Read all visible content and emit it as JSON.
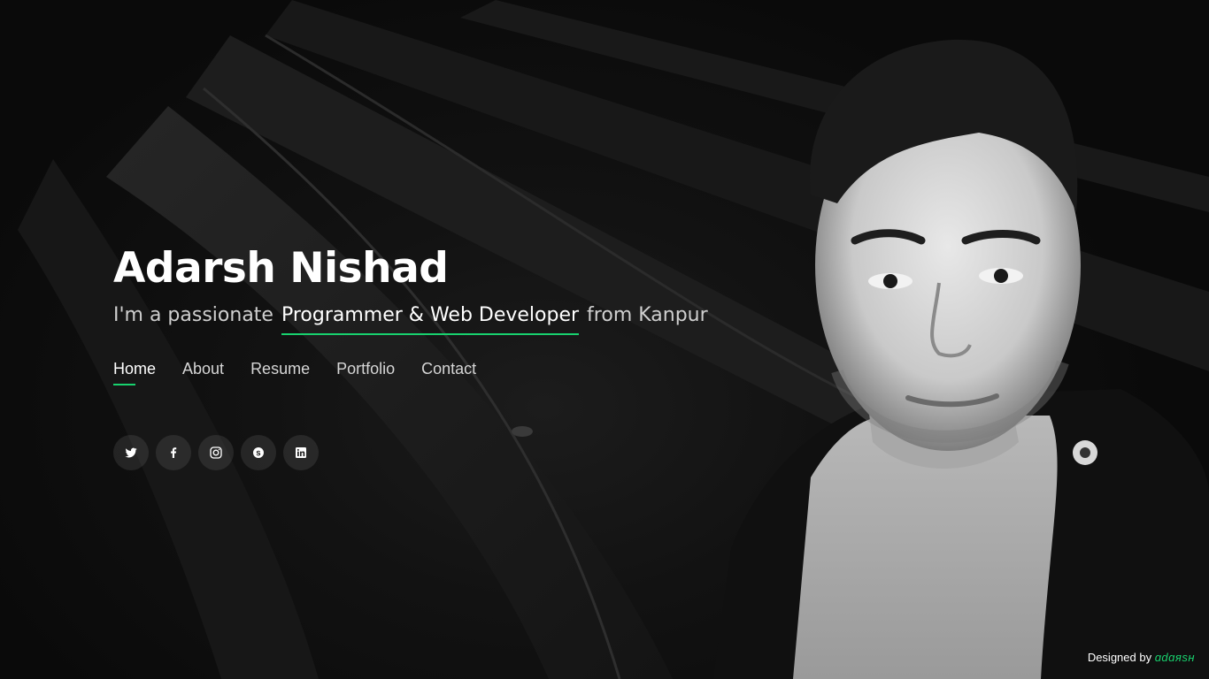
{
  "hero": {
    "name": "Adarsh Nishad",
    "tagline_prefix": "I'm a passionate ",
    "tagline_highlight": "Programmer & Web Developer",
    "tagline_suffix": " from Kanpur"
  },
  "nav": {
    "items": [
      {
        "label": "Home",
        "active": true
      },
      {
        "label": "About",
        "active": false
      },
      {
        "label": "Resume",
        "active": false
      },
      {
        "label": "Portfolio",
        "active": false
      },
      {
        "label": "Contact",
        "active": false
      }
    ]
  },
  "social": {
    "icons": [
      "twitter-icon",
      "facebook-icon",
      "instagram-icon",
      "skype-icon",
      "linkedin-icon"
    ]
  },
  "footer": {
    "credit_prefix": "Designed by ",
    "credit_brand": "ɑdɑяsн"
  },
  "colors": {
    "accent": "#18d26e",
    "background": "#0b0b0b",
    "text": "#ffffff",
    "muted": "#cfcfcf"
  }
}
